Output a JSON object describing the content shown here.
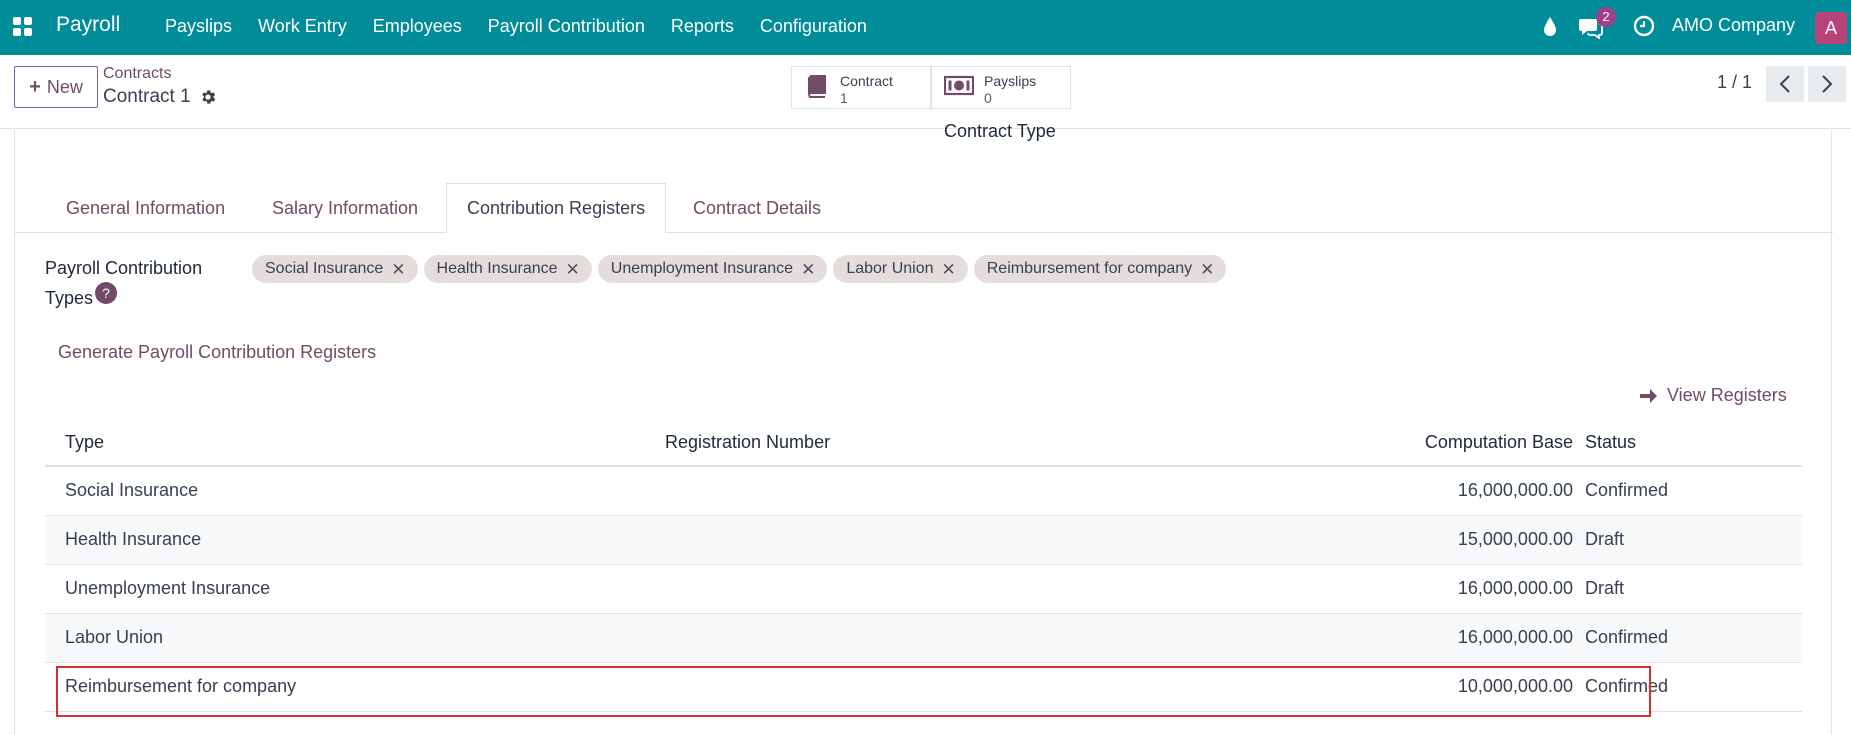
{
  "topbar": {
    "brand": "Payroll",
    "menu": [
      "Payslips",
      "Work Entry",
      "Employees",
      "Payroll Contribution",
      "Reports",
      "Configuration"
    ],
    "chat_count": "2",
    "company": "AMO Company",
    "avatar_letter": "A",
    "color": "#008c99"
  },
  "control": {
    "new_label": "New",
    "breadcrumb_parent": "Contracts",
    "breadcrumb_current": "Contract 1",
    "smart_buttons": {
      "contract": {
        "label": "Contract",
        "value": "1"
      },
      "payslips": {
        "label": "Payslips",
        "value": "0"
      }
    },
    "pager": "1 / 1"
  },
  "form": {
    "contract_type_label": "Contract Type",
    "tabs": [
      "General Information",
      "Salary Information",
      "Contribution Registers",
      "Contract Details"
    ],
    "active_tab": "Contribution Registers",
    "field_label_line1": "Payroll Contribution",
    "field_label_line2": "Types",
    "help_glyph": "?",
    "tags": [
      "Social Insurance",
      "Health Insurance",
      "Unemployment Insurance",
      "Labor Union",
      "Reimbursement for company"
    ],
    "generate_link": "Generate Payroll Contribution Registers",
    "view_registers": "View Registers"
  },
  "table": {
    "headers": [
      "Type",
      "Registration Number",
      "Computation Base",
      "Status"
    ],
    "rows": [
      {
        "type": "Social Insurance",
        "reg": "",
        "base": "16,000,000.00",
        "status": "Confirmed"
      },
      {
        "type": "Health Insurance",
        "reg": "",
        "base": "15,000,000.00",
        "status": "Draft"
      },
      {
        "type": "Unemployment Insurance",
        "reg": "",
        "base": "16,000,000.00",
        "status": "Draft"
      },
      {
        "type": "Labor Union",
        "reg": "",
        "base": "16,000,000.00",
        "status": "Confirmed"
      },
      {
        "type": "Reimbursement for company",
        "reg": "",
        "base": "10,000,000.00",
        "status": "Confirmed"
      }
    ]
  },
  "colors": {
    "accent": "#714B67",
    "highlight": "#d32f2f"
  }
}
